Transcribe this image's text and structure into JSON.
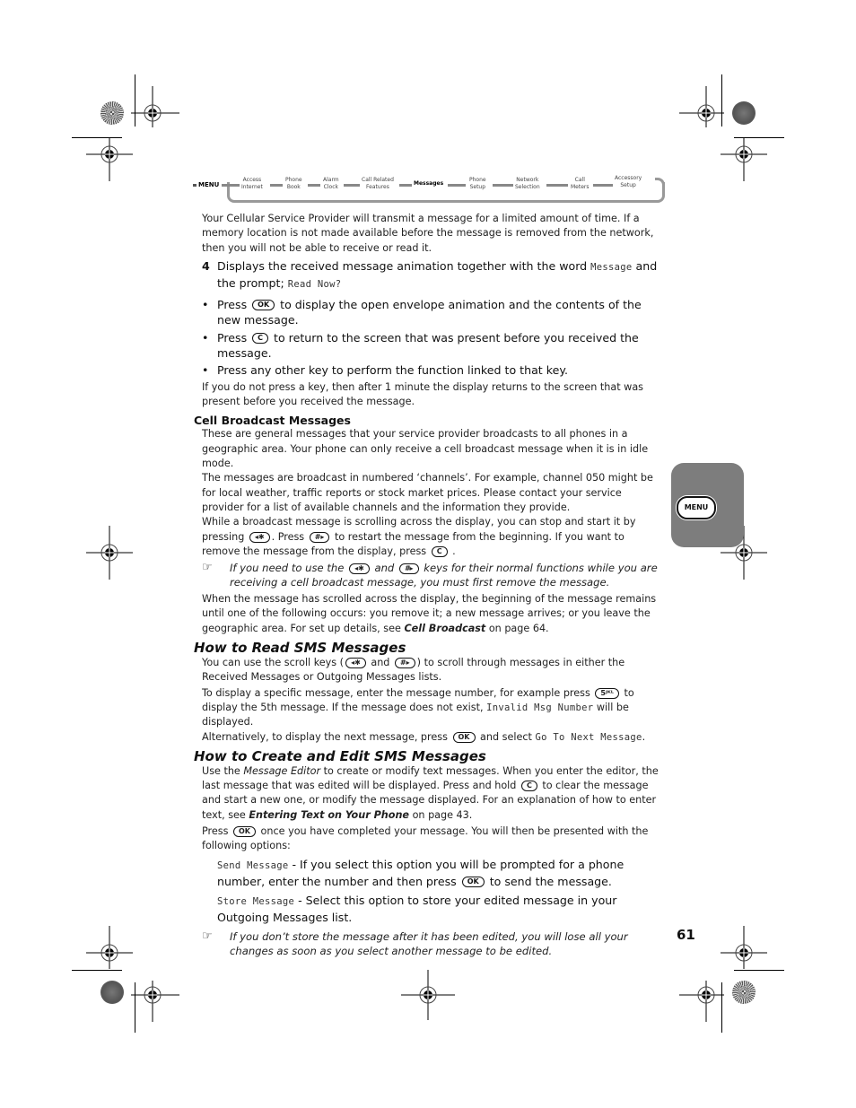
{
  "nav": {
    "menu_label": "MENU",
    "items": [
      {
        "line1": "Access",
        "line2": "Internet"
      },
      {
        "line1": "Phone",
        "line2": "Book"
      },
      {
        "line1": "Alarm",
        "line2": "Clock"
      },
      {
        "line1": "Call Related",
        "line2": "Features"
      },
      {
        "line1": "Messages",
        "line2": ""
      },
      {
        "line1": "Phone",
        "line2": "Setup"
      },
      {
        "line1": "Network",
        "line2": "Selection"
      },
      {
        "line1": "Call",
        "line2": "Meters"
      },
      {
        "line1": "Accessory",
        "line2": "Setup"
      }
    ],
    "active_item": "Messages"
  },
  "keys": {
    "ok": "OK",
    "c": "C",
    "star": "◂✱",
    "hash": "#▸",
    "five": "5ᴶᴷᴸ"
  },
  "intro": {
    "text": "Your Cellular Service Provider will transmit a message for a limited amount of time. If a memory location is not made available before the message is removed from the network, then you will not be able to receive or read it."
  },
  "step4": {
    "number": "4",
    "text_a": "Displays the received message animation together with the word ",
    "mono_a": "Message",
    "text_b": " and the prompt; ",
    "mono_b": "Read Now?"
  },
  "bullets": [
    {
      "pre": "Press ",
      "key": "OK",
      "post": " to display the open envelope animation and the contents of the new message."
    },
    {
      "pre": "Press ",
      "key": "C",
      "post": " to return to the screen that was present before you received the message."
    },
    {
      "pre": "Press any other key to perform the function linked to that key.",
      "key": "",
      "post": ""
    }
  ],
  "timeout_text": "If you do not press a key, then after 1 minute the display returns to the screen that was present before you received the message.",
  "cell_broadcast": {
    "heading": "Cell Broadcast Messages",
    "p1": "These are general messages that your service provider broadcasts to all phones in a geographic area. Your phone can only receive a cell broadcast message when it is in idle mode.",
    "p2": "The messages are broadcast in numbered ‘channels’. For example, channel 050 might be for local weather, traffic reports or stock market prices. Please contact your service provider for a list of available channels and the information they provide.",
    "p3_a": "While a broadcast message is scrolling across the display, you can stop and start it by pressing ",
    "p3_b": ". Press ",
    "p3_c": " to restart the message from the beginning. If you want to remove the message from the display, press ",
    "p3_d": " .",
    "note_a": "If you need to use the ",
    "note_b": " and ",
    "note_c": " keys for their normal functions while you are receiving a cell broadcast message, you must first remove the message.",
    "p4_a": "When the message has scrolled across the display, the beginning of the message remains until one of the following occurs: you remove it; a new message arrives; or you leave the geographic area. For set up details, see ",
    "p4_link": "Cell Broadcast",
    "p4_b": " on page 64."
  },
  "read_sms": {
    "heading": "How to Read SMS Messages",
    "p1_a": "You can use the scroll keys (",
    "p1_b": " and ",
    "p1_c": ") to scroll through messages in either the Received Messages or Outgoing Messages lists.",
    "p2_a": "To display a specific message, enter the message number, for example press ",
    "p2_b": " to display the 5th message. If the message does not exist, ",
    "p2_mono": "Invalid Msg Number",
    "p2_c": " will be displayed.",
    "p3_a": "Alternatively, to display the next message, press ",
    "p3_b": " and select ",
    "p3_mono": "Go To Next Message",
    "p3_c": "."
  },
  "create_sms": {
    "heading": "How to Create and Edit SMS Messages",
    "p1_a": "Use the ",
    "p1_it": "Message Editor",
    "p1_b": " to create or modify text messages. When you enter the editor, the last message that was edited will be displayed. Press and hold ",
    "p1_c": " to clear the message and start a new one, or modify the message displayed. For an explanation of how to enter text, see ",
    "p1_link": "Entering Text on Your Phone",
    "p1_d": " on page 43.",
    "p2_a": "Press ",
    "p2_b": " once you have completed your message. You will then be presented with the following options:",
    "opt1_mono": "Send Message",
    "opt1_a": " - If you select this option you will be prompted for a phone number, enter the number and then press ",
    "opt1_b": " to send the message.",
    "opt2_mono": "Store Message",
    "opt2_a": " - Select this option to store your edited message in your Outgoing Messages list.",
    "note": "If you don’t store the message after it has been edited, you will lose all your changes as soon as you select another message to be edited."
  },
  "side_tab": {
    "label": "MENU",
    "color": "#7d7d7d"
  },
  "page_number": "61",
  "icons": {
    "note": "pointing-hand-note-icon"
  }
}
